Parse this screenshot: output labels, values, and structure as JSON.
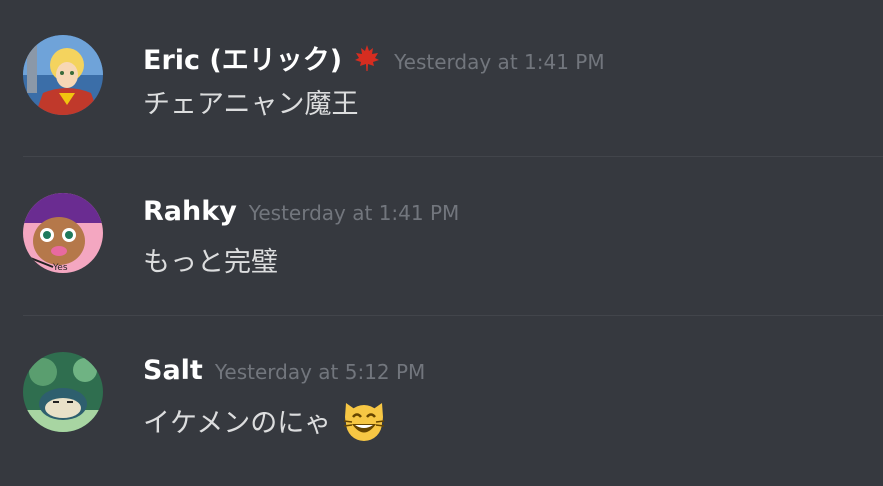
{
  "messages": [
    {
      "username": "Eric (エリック)",
      "badge_icon": "maple-leaf-icon",
      "timestamp": "Yesterday at 1:41 PM",
      "text": "チェアニャン魔王",
      "avatar_colors": [
        "#c0392b",
        "#f1c40f"
      ]
    },
    {
      "username": "Rahky",
      "timestamp": "Yesterday at 1:41 PM",
      "text": "もっと完璧",
      "avatar_colors": [
        "#6a2c91",
        "#f4a7c1"
      ]
    },
    {
      "username": "Salt",
      "timestamp": "Yesterday at 5:12 PM",
      "text": "イケメンのにゃ",
      "emoji_icon": "smiley-cat-laughing-icon",
      "avatar_colors": [
        "#2f6e4f",
        "#a8d5a2"
      ]
    }
  ],
  "colors": {
    "background": "#36393f",
    "username": "#ffffff",
    "timestamp": "#72767d",
    "message_text": "#dcddde",
    "divider": "#42454b"
  }
}
